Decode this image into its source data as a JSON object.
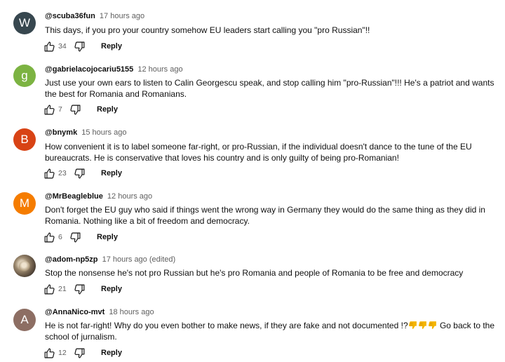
{
  "comments": [
    {
      "avatar_letter": "W",
      "avatar_color": "#37474f",
      "handle": "@scuba36fun",
      "time": "17 hours ago",
      "text": "This days, if you pro your country somehow EU leaders start calling you \"pro Russian\"!!",
      "likes": "34",
      "reply_label": "Reply"
    },
    {
      "avatar_letter": "g",
      "avatar_color": "#7cb342",
      "handle": "@gabrielacojocariu5155",
      "time": "12 hours ago",
      "text": "Just use your own ears to listen to Calin Georgescu speak, and stop calling him \"pro-Russian\"!!! He's a patriot and wants the best for Romania and Romanians.",
      "likes": "7",
      "reply_label": "Reply"
    },
    {
      "avatar_letter": "B",
      "avatar_color": "#d84315",
      "handle": "@bnymk",
      "time": "15 hours ago",
      "text": "How convenient it is to label someone far-right, or pro-Russian, if the individual doesn't dance to the tune of the EU bureaucrats. He is conservative that loves his country and is only guilty of being pro-Romanian!",
      "likes": "23",
      "reply_label": "Reply"
    },
    {
      "avatar_letter": "M",
      "avatar_color": "#f57c00",
      "handle": "@MrBeagleblue",
      "time": "12 hours ago",
      "text": "Don't forget the EU guy who said if things went the wrong way in Germany they would do the same thing as they did in Romania. Nothing like a bit of freedom and democracy.",
      "likes": "6",
      "reply_label": "Reply"
    },
    {
      "avatar_letter": "",
      "avatar_color": "#7a6a56",
      "handle": "@adom-np5zp",
      "time": "17 hours ago (edited)",
      "text": "Stop the nonsense he's not pro Russian but he's pro Romania and people of Romania to be free and democracy",
      "likes": "21",
      "reply_label": "Reply"
    },
    {
      "avatar_letter": "A",
      "avatar_color": "#8d6e63",
      "handle": "@AnnaNico-mvt",
      "time": "18 hours ago",
      "text_before_emoji": "He is not far-right! Why do you even bother to make news, if they are fake and not documented !?",
      "emoji_count_name": "thumbs-down-emoji x3",
      "text_after_emoji": " Go back to the school of jurnalism.",
      "likes": "12",
      "reply_label": "Reply"
    }
  ],
  "icons": {
    "like": "thumbs-up-outline-icon",
    "dislike": "thumbs-down-outline-icon",
    "emoji": "thumbs-down-emoji"
  },
  "colors": {
    "text": "#0f0f0f",
    "secondary": "#606060",
    "emoji": "#f4b400"
  }
}
